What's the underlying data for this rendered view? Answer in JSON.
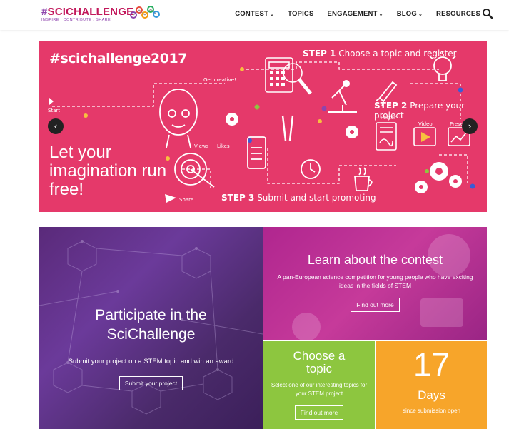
{
  "header": {
    "logo_hash": "#",
    "logo_name": "SCICHALLENGE",
    "logo_tagline": "INSPIRE . CONTRIBUTE . SHARE",
    "nav": [
      {
        "label": "CONTEST",
        "has_dropdown": true
      },
      {
        "label": "TOPICS",
        "has_dropdown": false
      },
      {
        "label": "ENGAGEMENT",
        "has_dropdown": true
      },
      {
        "label": "BLOG",
        "has_dropdown": true
      },
      {
        "label": "RESOURCES",
        "has_dropdown": false
      }
    ],
    "caret": "⌄",
    "search_icon": "search-icon"
  },
  "banner": {
    "hashtag": "#scichallenge2017",
    "slogan": "Let your imagination run free!",
    "step1_num": "STEP 1",
    "step1_text": "Choose a topic and register",
    "step2_num": "STEP 2",
    "step2_text": "Prepare your project",
    "step3_num": "STEP 3",
    "step3_text": "Submit and start promoting",
    "label_start": "Start",
    "label_creative": "Get creative!",
    "label_poster": "Poster",
    "label_video": "Video",
    "label_presentation": "Presen",
    "label_views": "Views",
    "label_likes": "Likes",
    "label_share": "Share",
    "prev_arrow": "‹",
    "next_arrow": "›",
    "colors": {
      "background": "#e5396a"
    }
  },
  "tiles": {
    "participate": {
      "title": "Participate in the SciChallenge",
      "subtitle": "Submit your project on a STEM topic and win an award",
      "button": "Submit your project"
    },
    "learn": {
      "title": "Learn about the contest",
      "subtitle": "A pan-European science competition for young people who have exciting ideas in the fields of STEM",
      "button": "Find out more"
    },
    "choose": {
      "title": "Choose a topic",
      "subtitle": "Select one of our interesting topics for your STEM project",
      "button": "Find out more"
    },
    "days": {
      "number": "17",
      "unit": "Days",
      "caption": "since submission open"
    },
    "colors": {
      "participate": "#5a2a7a",
      "learn": "#b0268f",
      "choose": "#8dc63f",
      "days": "#f7a52a"
    }
  }
}
